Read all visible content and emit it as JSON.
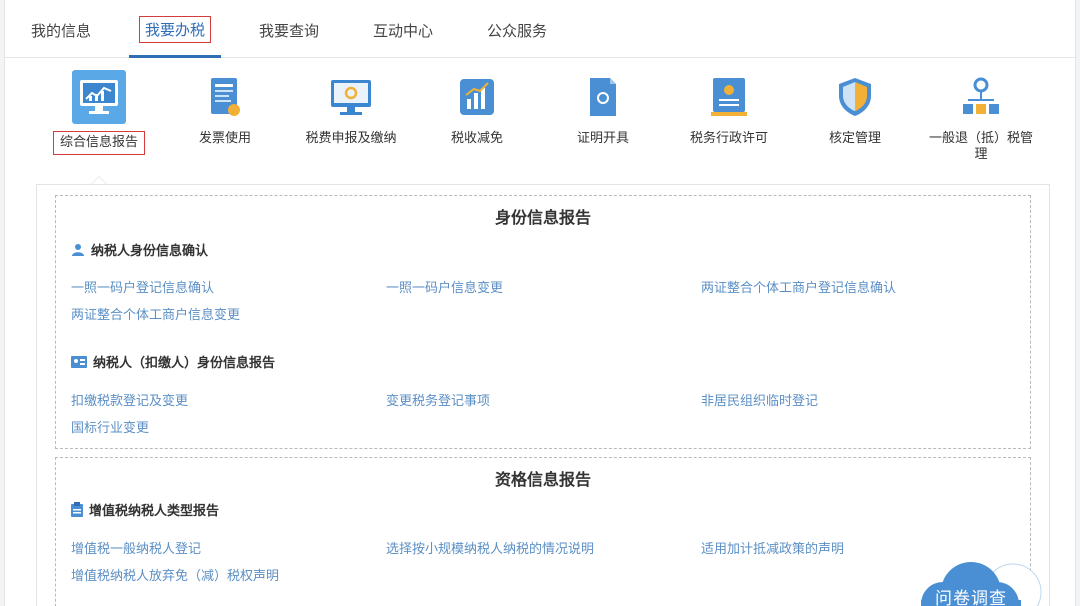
{
  "tabs": [
    {
      "label": "我的信息"
    },
    {
      "label": "我要办税"
    },
    {
      "label": "我要查询"
    },
    {
      "label": "互动中心"
    },
    {
      "label": "公众服务"
    }
  ],
  "categories": [
    {
      "label": "综合信息报告",
      "icon": "report-monitor-icon"
    },
    {
      "label": "发票使用",
      "icon": "invoice-icon"
    },
    {
      "label": "税费申报及缴纳",
      "icon": "monitor-icon"
    },
    {
      "label": "税收减免",
      "icon": "chart-card-icon"
    },
    {
      "label": "证明开具",
      "icon": "certificate-icon"
    },
    {
      "label": "税务行政许可",
      "icon": "license-icon"
    },
    {
      "label": "核定管理",
      "icon": "shield-icon"
    },
    {
      "label": "一般退（抵）税管",
      "label2": "理",
      "icon": "org-chart-icon"
    }
  ],
  "sections": [
    {
      "title": "身份信息报告",
      "groups": [
        {
          "title": "纳税人身份信息确认",
          "icon": "person-icon",
          "links": [
            "一照一码户登记信息确认",
            "一照一码户信息变更",
            "两证整合个体工商户登记信息确认",
            "两证整合个体工商户信息变更"
          ]
        },
        {
          "title": "纳税人（扣缴人）身份信息报告",
          "icon": "id-card-icon",
          "links": [
            "扣缴税款登记及变更",
            "变更税务登记事项",
            "非居民组织临时登记",
            "国标行业变更"
          ]
        }
      ]
    },
    {
      "title": "资格信息报告",
      "groups": [
        {
          "title": "增值税纳税人类型报告",
          "icon": "clipboard-icon",
          "links": [
            "增值税一般纳税人登记",
            "选择按小规模纳税人纳税的情况说明",
            "适用加计抵减政策的声明",
            "增值税纳税人放弃免（减）税权声明"
          ]
        }
      ]
    }
  ],
  "survey": {
    "label": "问卷调查"
  },
  "colors": {
    "accent": "#2f6db5",
    "link": "#5b8fc5",
    "highlight_border": "#d43b3b"
  }
}
